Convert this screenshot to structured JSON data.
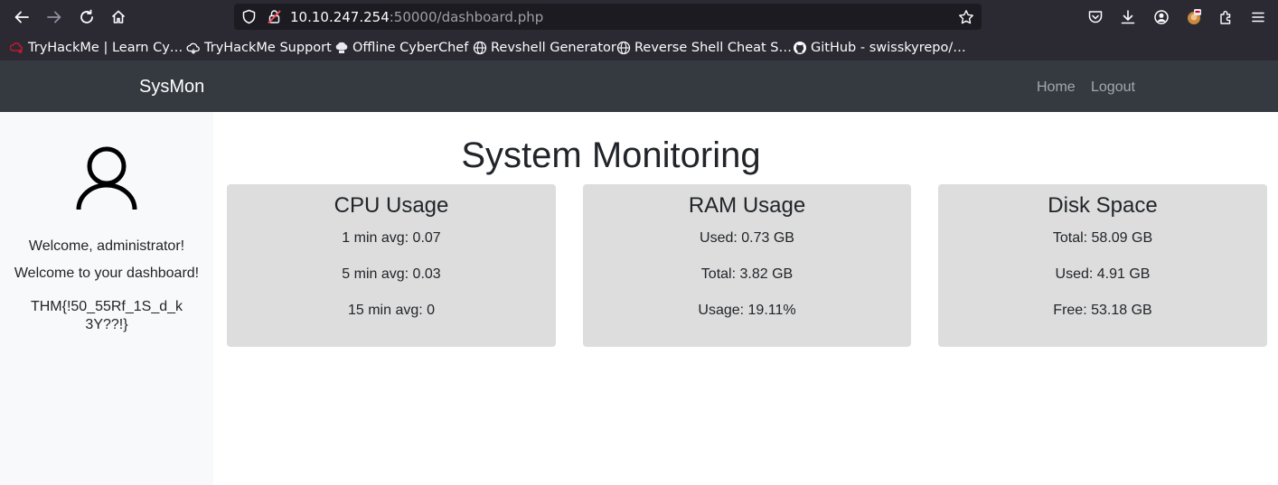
{
  "browser": {
    "url_host": "10.10.247.254",
    "url_rest": ":50000/dashboard.php",
    "bookmarks": [
      {
        "label": "TryHackMe | Learn Cy…",
        "icon": "tryhackme-icon"
      },
      {
        "label": "TryHackMe Support",
        "icon": "cloud-icon"
      },
      {
        "label": "Offline CyberChef",
        "icon": "chef-hat-icon"
      },
      {
        "label": "Revshell Generator",
        "icon": "globe-icon"
      },
      {
        "label": "Reverse Shell Cheat S…",
        "icon": "globe-icon"
      },
      {
        "label": "GitHub - swisskyrepo/…",
        "icon": "github-icon"
      }
    ]
  },
  "navbar": {
    "brand": "SysMon",
    "links": [
      "Home",
      "Logout"
    ]
  },
  "sidebar": {
    "welcome": "Welcome, administrator!",
    "dashboard_text": "Welcome to your dashboard!",
    "flag": "THM{!50_55Rf_1S_d_k3Y??!}"
  },
  "main": {
    "title": "System Monitoring",
    "cards": [
      {
        "title": "CPU Usage",
        "lines": [
          "1 min avg: 0.07",
          "5 min avg: 0.03",
          "15 min avg: 0"
        ]
      },
      {
        "title": "RAM Usage",
        "lines": [
          "Used: 0.73 GB",
          "Total: 3.82 GB",
          "Usage: 19.11%"
        ]
      },
      {
        "title": "Disk Space",
        "lines": [
          "Total: 58.09 GB",
          "Used: 4.91 GB",
          "Free: 53.18 GB"
        ]
      }
    ]
  },
  "colors": {
    "navbar_bg": "#343a40",
    "sidebar_bg": "#f8f9fa",
    "card_bg": "#dddddd",
    "browser_bg": "#2b2a33"
  }
}
